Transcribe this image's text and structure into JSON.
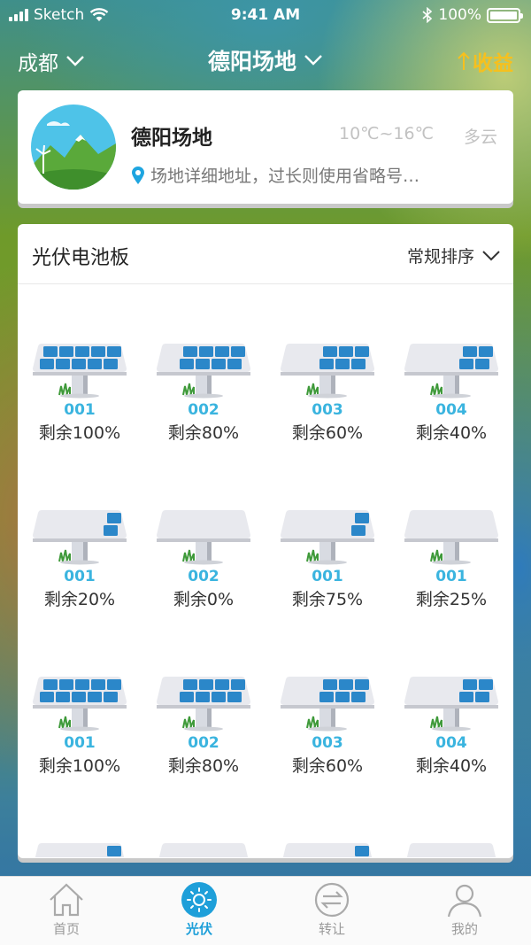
{
  "status_bar": {
    "carrier": "Sketch",
    "time": "9:41 AM",
    "battery": "100%",
    "icons": [
      "signal-icon",
      "wifi-icon",
      "bluetooth-icon",
      "battery-icon"
    ]
  },
  "nav": {
    "city": "成都",
    "title": "德阳场地",
    "earnings_label": "收益",
    "earnings_color": "#f6c01e"
  },
  "site": {
    "name": "德阳场地",
    "temperature": "10℃~16℃",
    "weather": "多云",
    "address": "场地详细地址，过长则使用省略号…"
  },
  "panels_section": {
    "title": "光伏电池板",
    "sort_label": "常规排序",
    "items": [
      {
        "id": "001",
        "remain": "剩余100%",
        "level": 1.0
      },
      {
        "id": "002",
        "remain": "剩余80%",
        "level": 0.8
      },
      {
        "id": "003",
        "remain": "剩余60%",
        "level": 0.6
      },
      {
        "id": "004",
        "remain": "剩余40%",
        "level": 0.4
      },
      {
        "id": "001",
        "remain": "剩余20%",
        "level": 0.2
      },
      {
        "id": "002",
        "remain": "剩余0%",
        "level": 0.0
      },
      {
        "id": "001",
        "remain": "剩余75%",
        "level": 0.2
      },
      {
        "id": "001",
        "remain": "剩余25%",
        "level": 0.0
      },
      {
        "id": "001",
        "remain": "剩余100%",
        "level": 1.0
      },
      {
        "id": "002",
        "remain": "剩余80%",
        "level": 0.8
      },
      {
        "id": "003",
        "remain": "剩余60%",
        "level": 0.6
      },
      {
        "id": "004",
        "remain": "剩余40%",
        "level": 0.4
      }
    ],
    "partial_row_levels": [
      0.2,
      0.0,
      0.2,
      0.0
    ]
  },
  "tabs": [
    {
      "label": "首页",
      "icon": "home-icon",
      "active": false
    },
    {
      "label": "光伏",
      "icon": "sun-icon",
      "active": true
    },
    {
      "label": "转让",
      "icon": "transfer-icon",
      "active": false
    },
    {
      "label": "我的",
      "icon": "profile-icon",
      "active": false
    }
  ],
  "colors": {
    "accent": "#1e9fd9",
    "panel_blue": "#2b87c9",
    "panel_id": "#3ab4df"
  }
}
